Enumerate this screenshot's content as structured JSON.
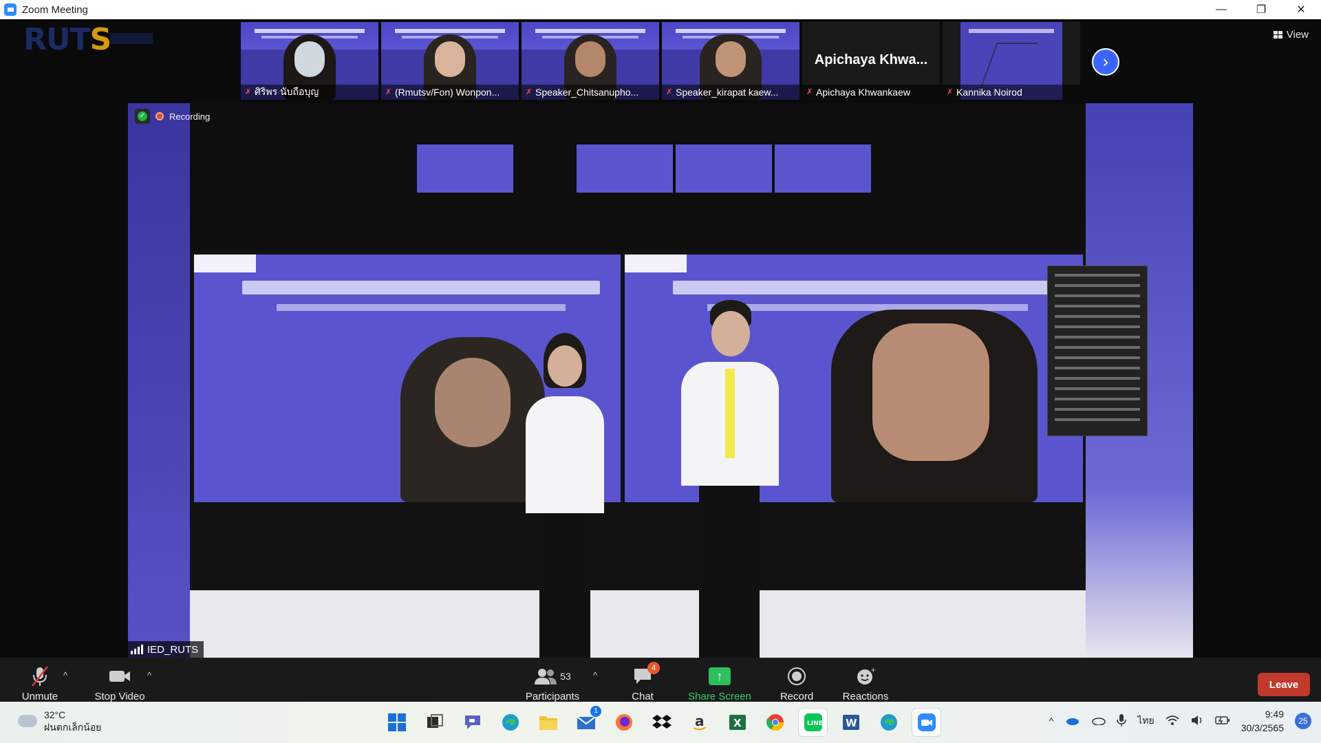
{
  "window": {
    "title": "Zoom Meeting",
    "controls": {
      "minimize": "—",
      "restore": "❐",
      "close": "✕"
    }
  },
  "header": {
    "logo_text_a": "RUT",
    "logo_text_b": "S",
    "view_label": "View"
  },
  "thumbnails": [
    {
      "name": "ศิริพร นับถือบุญ",
      "muted": true
    },
    {
      "name": "(Rmutsv/Fon) Wonpon...",
      "muted": true
    },
    {
      "name": "Speaker_Chitsanupho...",
      "muted": true
    },
    {
      "name": "Speaker_kirapat kaew...",
      "muted": true
    },
    {
      "name": "Apichaya Khwankaew",
      "big_name": "Apichaya  Khwa...",
      "muted": true
    },
    {
      "name": "Kannika Noirod",
      "muted": true
    }
  ],
  "main_video": {
    "recording_label": "Recording",
    "speaker_name": "IED_RUTS"
  },
  "toolbar": {
    "unmute": "Unmute",
    "stop_video": "Stop Video",
    "participants": "Participants",
    "participants_count": "53",
    "chat": "Chat",
    "chat_badge": "4",
    "share_screen": "Share Screen",
    "record": "Record",
    "reactions": "Reactions",
    "leave": "Leave"
  },
  "taskbar": {
    "weather_temp": "32°C",
    "weather_desc": "ฝนตกเล็กน้อย",
    "mail_badge": "1",
    "lang": "ไทย",
    "time": "9:49",
    "date": "30/3/2565",
    "notifications": "25"
  }
}
